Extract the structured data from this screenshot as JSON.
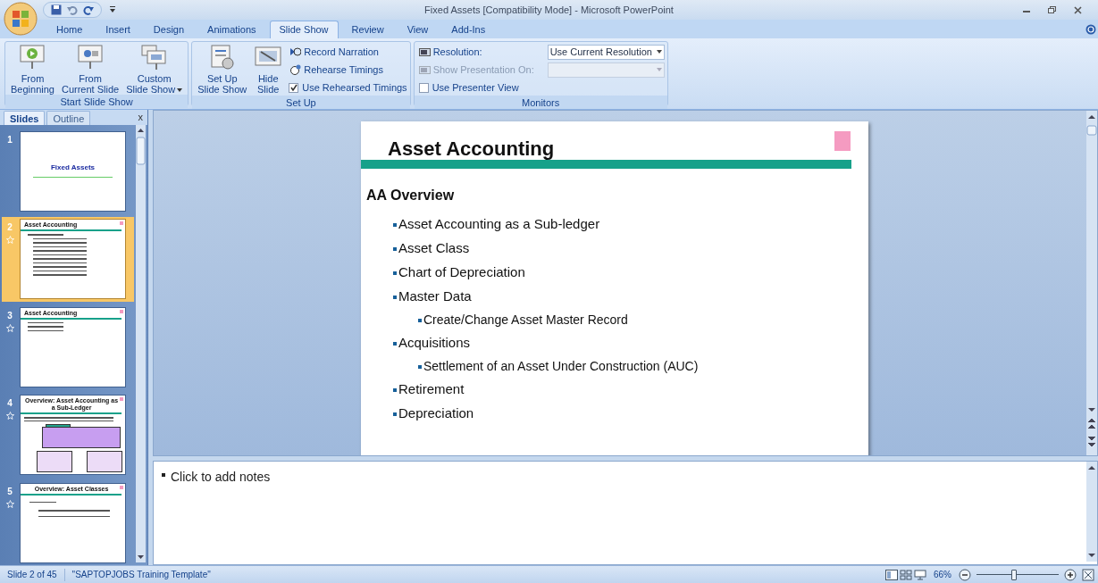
{
  "window": {
    "title": "Fixed Assets [Compatibility Mode] - Microsoft PowerPoint"
  },
  "tabs": [
    {
      "label": "Home",
      "selected": false
    },
    {
      "label": "Insert",
      "selected": false
    },
    {
      "label": "Design",
      "selected": false
    },
    {
      "label": "Animations",
      "selected": false
    },
    {
      "label": "Slide Show",
      "selected": true
    },
    {
      "label": "Review",
      "selected": false
    },
    {
      "label": "View",
      "selected": false
    },
    {
      "label": "Add-Ins",
      "selected": false
    }
  ],
  "ribbon": {
    "groups": [
      {
        "title": "Start Slide Show",
        "items": [
          {
            "kind": "large",
            "label": "From\nBeginning",
            "dropdown": false
          },
          {
            "kind": "large",
            "label": "From\nCurrent Slide",
            "dropdown": false
          },
          {
            "kind": "large",
            "label": "Custom\nSlide Show",
            "dropdown": true
          }
        ]
      },
      {
        "title": "Set Up",
        "items": [
          {
            "kind": "large",
            "label": "Set Up\nSlide Show",
            "dropdown": false
          },
          {
            "kind": "large",
            "label": "Hide\nSlide",
            "dropdown": false
          },
          {
            "kind": "stack",
            "rows": [
              {
                "kind": "command",
                "label": "Record Narration",
                "disabled": false
              },
              {
                "kind": "command",
                "label": "Rehearse Timings",
                "disabled": false
              },
              {
                "kind": "checkbox",
                "label": "Use Rehearsed Timings",
                "checked": true
              }
            ]
          }
        ]
      },
      {
        "title": "Monitors",
        "items": [
          {
            "kind": "stack",
            "rows": [
              {
                "kind": "select",
                "label": "Resolution:",
                "value": "Use Current Resolution",
                "disabled": false
              },
              {
                "kind": "select",
                "label": "Show Presentation On:",
                "disabled": true
              },
              {
                "kind": "checkbox",
                "label": "Use Presenter View",
                "checked": false
              }
            ]
          }
        ]
      }
    ]
  },
  "pane_tabs": [
    {
      "label": "Slides",
      "selected": true
    },
    {
      "label": "Outline",
      "selected": false
    }
  ],
  "pane_close": "x",
  "slides": [
    {
      "number": "1",
      "kind": "title",
      "title": "Fixed Assets",
      "selected": false,
      "animated": false
    },
    {
      "number": "2",
      "kind": "bullets",
      "title": "Asset Accounting",
      "selected": true,
      "animated": true
    },
    {
      "number": "3",
      "kind": "bullets",
      "title": "Asset Accounting",
      "selected": false,
      "animated": true
    },
    {
      "number": "4",
      "kind": "diagram",
      "title": "Overview:  Asset Accounting as a Sub-Ledger",
      "selected": false,
      "animated": true
    },
    {
      "number": "5",
      "kind": "text",
      "title": "Overview:  Asset Classes",
      "selected": false,
      "animated": true
    }
  ],
  "slide": {
    "title": "Asset Accounting",
    "heading": "AA Overview",
    "bullets": [
      {
        "text": "Asset Accounting as a Sub-ledger"
      },
      {
        "text": "Asset Class"
      },
      {
        "text": "Chart of Depreciation"
      },
      {
        "text": "Master Data",
        "children": [
          {
            "text": "Create/Change Asset Master Record"
          }
        ]
      },
      {
        "text": "Acquisitions",
        "children": [
          {
            "text": "Settlement of an Asset Under Construction (AUC)"
          }
        ]
      },
      {
        "text": "Retirement"
      },
      {
        "text": "Depreciation"
      }
    ]
  },
  "notes": {
    "placeholder": "Click to add notes"
  },
  "status_bar": {
    "slide": "Slide 2 of 45",
    "template": "\"SAPTOPJOBS Training Template\"",
    "zoom": "66%",
    "zoom_slider": {
      "level": 0.45
    }
  }
}
